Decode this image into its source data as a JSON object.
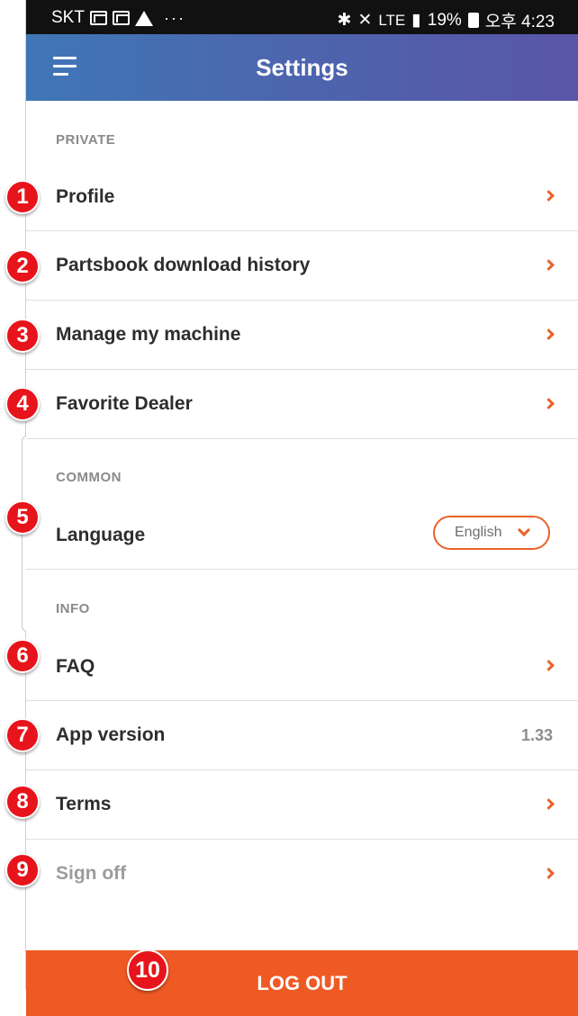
{
  "status_bar": {
    "carrier": "SKT",
    "dots": "···",
    "network": "LTE",
    "battery_percent": "19%",
    "time": "오후 4:23"
  },
  "appbar": {
    "title": "Settings",
    "menu_icon": "hamburger-menu-icon"
  },
  "sections": {
    "private": {
      "header": "PRIVATE",
      "items": [
        {
          "label": "Profile"
        },
        {
          "label": "Partsbook download history"
        },
        {
          "label": "Manage my machine"
        },
        {
          "label": "Favorite Dealer"
        }
      ]
    },
    "common": {
      "header": "COMMON",
      "language_label": "Language",
      "language_value": "English"
    },
    "info": {
      "header": "INFO",
      "faq_label": "FAQ",
      "app_version_label": "App version",
      "app_version_value": "1.33",
      "terms_label": "Terms",
      "sign_off_label": "Sign off"
    }
  },
  "logout_label": "LOG OUT",
  "annotations": [
    "1",
    "2",
    "3",
    "4",
    "5",
    "6",
    "7",
    "8",
    "9",
    "10"
  ],
  "colors": {
    "accent": "#e8622c",
    "logout_bg": "#ef5a24",
    "appbar_gradient_start": "#3f76b7",
    "appbar_gradient_end": "#5b55a8",
    "badge": "#e8141b"
  }
}
